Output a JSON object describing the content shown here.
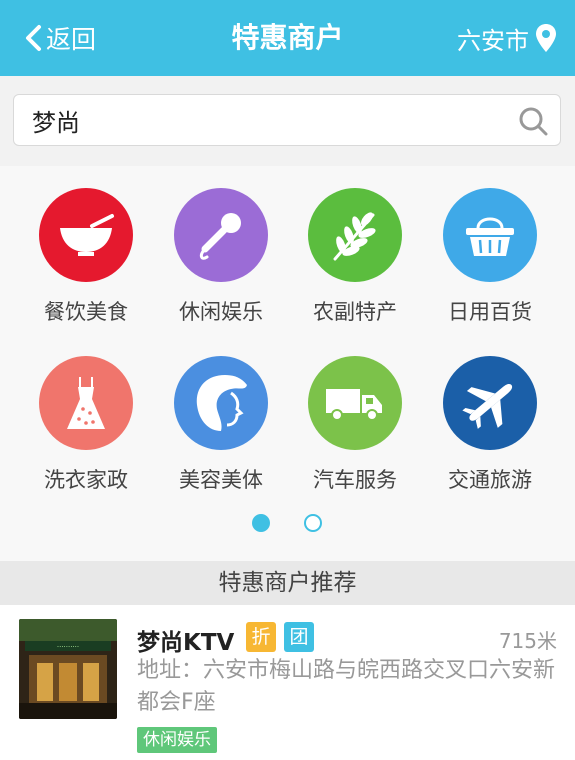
{
  "header": {
    "back_label": "返回",
    "title": "特惠商户",
    "city": "六安市",
    "accent_color": "#3fc0e3"
  },
  "search": {
    "value": "梦尚",
    "placeholder": ""
  },
  "categories": [
    {
      "label": "餐饮美食",
      "icon": "bowl-icon",
      "color": "#e5192e"
    },
    {
      "label": "休闲娱乐",
      "icon": "microphone-icon",
      "color": "#9b6cd6"
    },
    {
      "label": "农副特产",
      "icon": "wheat-icon",
      "color": "#5bbd3e"
    },
    {
      "label": "日用百货",
      "icon": "basket-icon",
      "color": "#3fa9e8"
    },
    {
      "label": "洗衣家政",
      "icon": "dress-icon",
      "color": "#f0756c"
    },
    {
      "label": "美容美体",
      "icon": "face-icon",
      "color": "#4b8fe0"
    },
    {
      "label": "汽车服务",
      "icon": "truck-icon",
      "color": "#7cc24a"
    },
    {
      "label": "交通旅游",
      "icon": "airplane-icon",
      "color": "#1b5fa8"
    }
  ],
  "pager": {
    "pages": 2,
    "current": 1
  },
  "recommend": {
    "header": "特惠商户推荐",
    "items": [
      {
        "name": "梦尚KTV",
        "badge_discount": "折",
        "badge_group": "团",
        "distance": "715米",
        "address": "地址：六安市梅山路与皖西路交叉口六安新都会F座",
        "tag": "休闲娱乐"
      }
    ]
  }
}
